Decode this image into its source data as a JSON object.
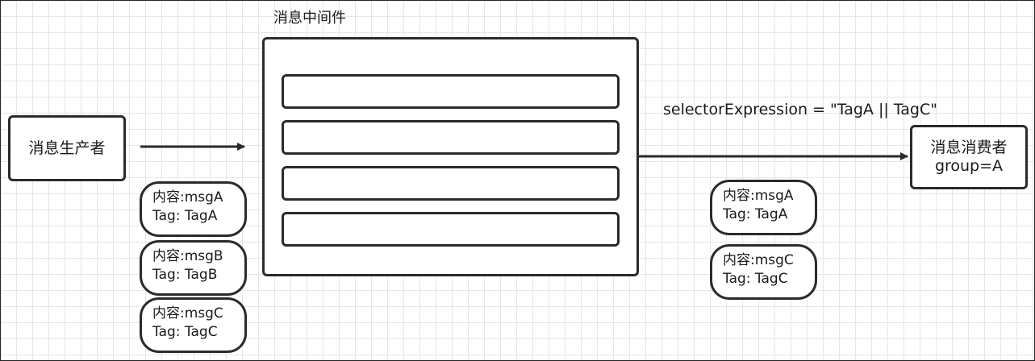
{
  "producer": {
    "label": "消息生产者"
  },
  "middleware": {
    "title": "消息中间件",
    "queue_count": 4
  },
  "consumer": {
    "line1": "消息消费者",
    "line2": "group=A"
  },
  "selector": {
    "expression": "selectorExpression  =  \"TagA || TagC\""
  },
  "produced_messages": [
    {
      "content": "内容:msgA",
      "tag": "Tag: TagA"
    },
    {
      "content": "内容:msgB",
      "tag": "Tag: TagB"
    },
    {
      "content": "内容:msgC",
      "tag": "Tag: TagC"
    }
  ],
  "consumed_messages": [
    {
      "content": "内容:msgA",
      "tag": "Tag: TagA"
    },
    {
      "content": "内容:msgC",
      "tag": "Tag: TagC"
    }
  ],
  "colors": {
    "stroke": "#2b2b2b",
    "grid": "#e6e6e6",
    "background": "#ffffff"
  }
}
